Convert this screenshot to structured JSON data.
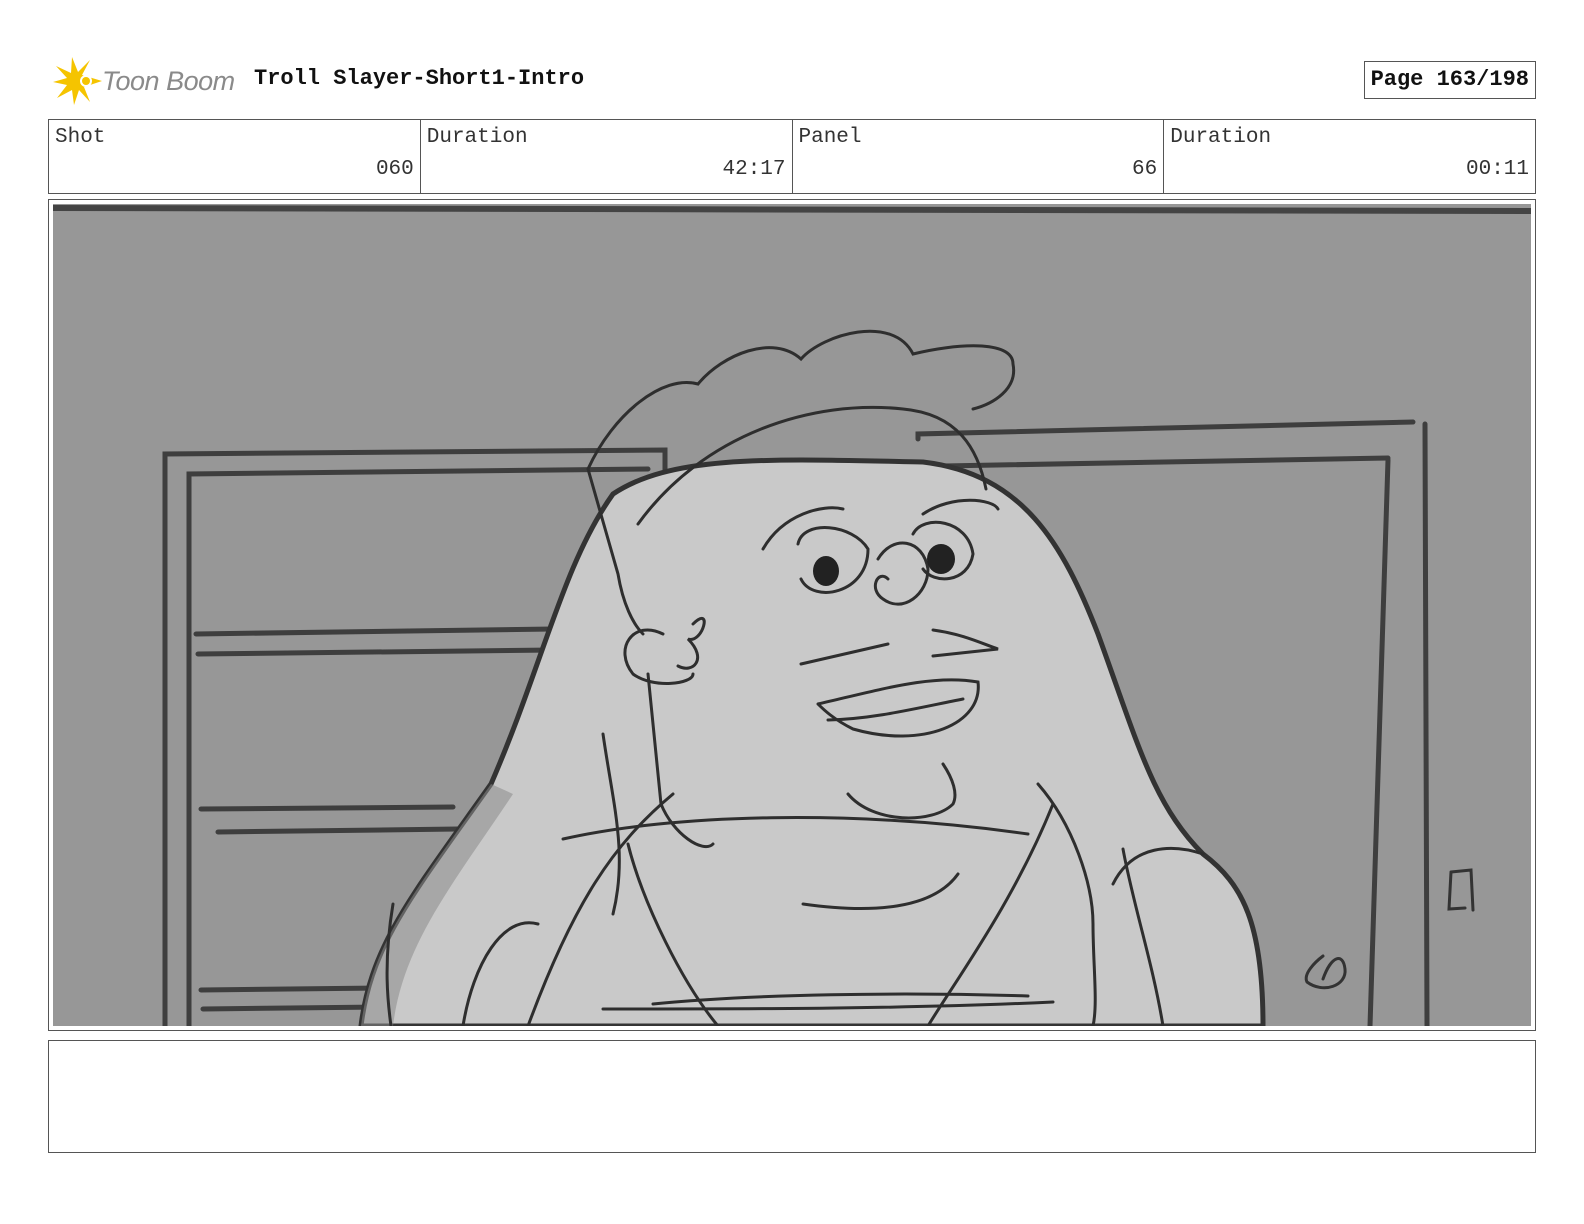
{
  "header": {
    "logo_text": "Toon Boom",
    "title": "Troll Slayer-Short1-Intro",
    "page": "Page 163/198"
  },
  "info": [
    {
      "label": "Shot",
      "value": "060"
    },
    {
      "label": "Duration",
      "value": "42:17"
    },
    {
      "label": "Panel",
      "value": "66"
    },
    {
      "label": "Duration",
      "value": "00:11"
    }
  ],
  "panel": {
    "icon": "storyboard-sketch-character-smiling",
    "background_color": "#979797",
    "figure_color": "#c9c9c9"
  },
  "notes": {
    "text": ""
  }
}
